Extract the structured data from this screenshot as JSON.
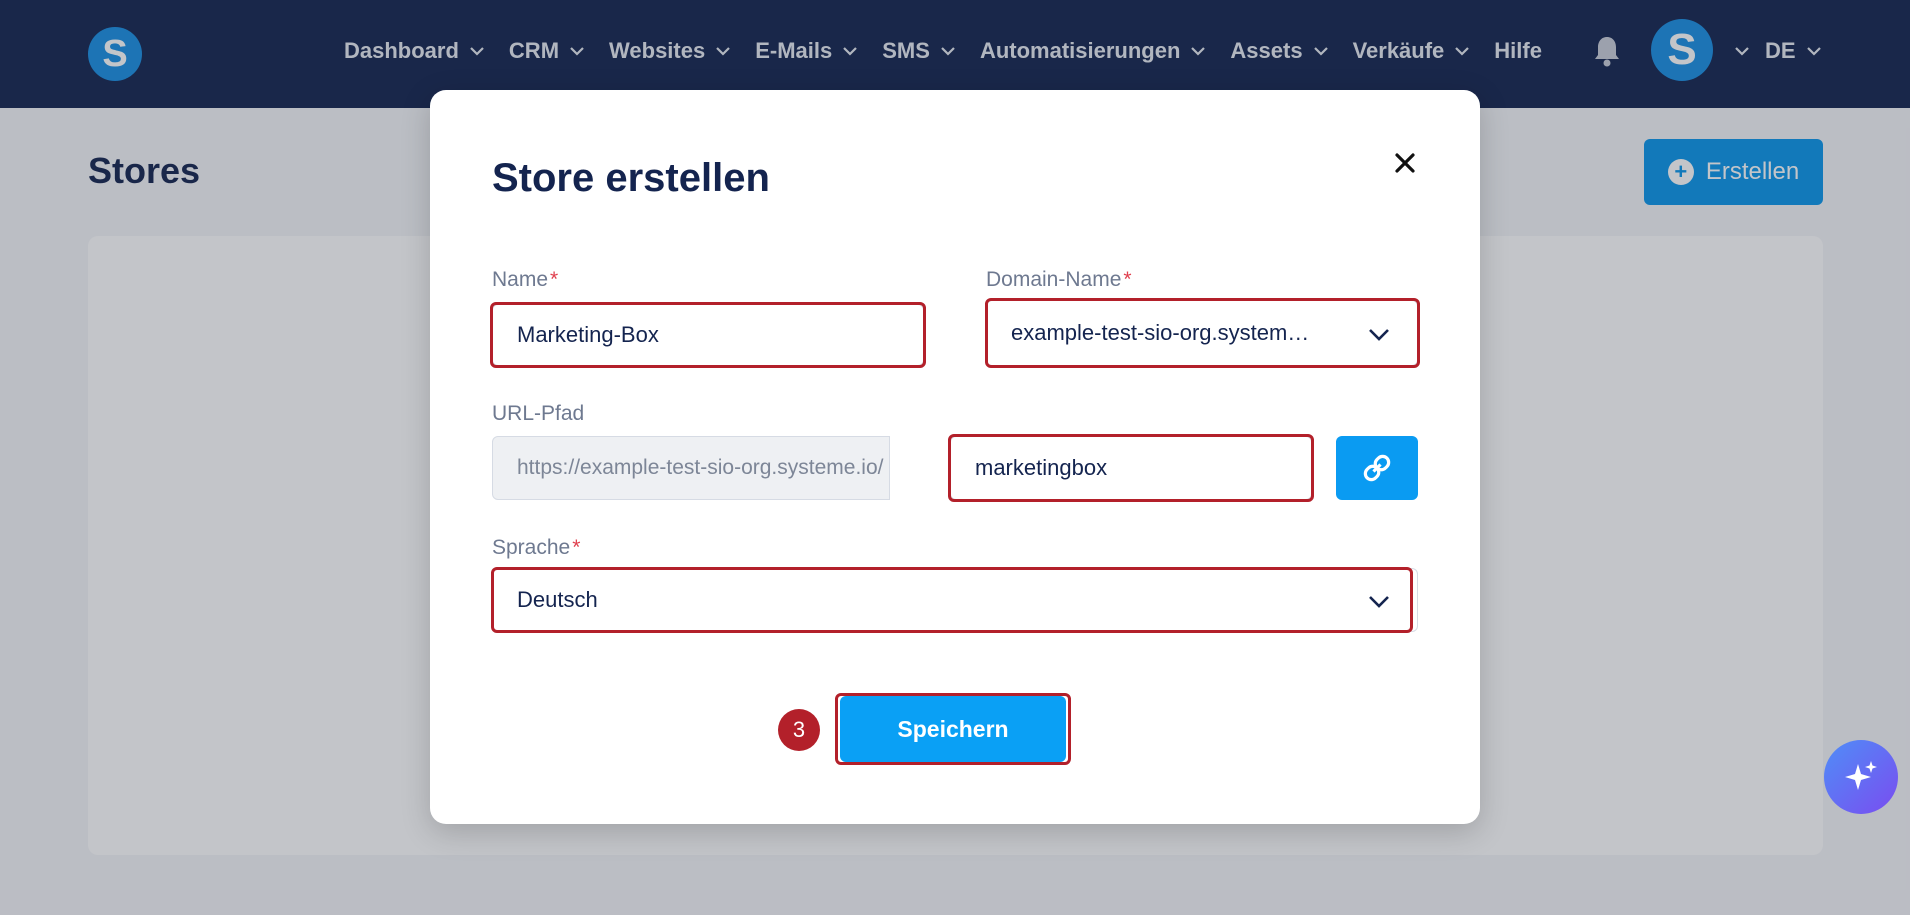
{
  "nav": {
    "logo_letter": "S",
    "items": [
      {
        "label": "Dashboard",
        "has_dropdown": true
      },
      {
        "label": "CRM",
        "has_dropdown": true
      },
      {
        "label": "Websites",
        "has_dropdown": true
      },
      {
        "label": "E-Mails",
        "has_dropdown": true
      },
      {
        "label": "SMS",
        "has_dropdown": true
      },
      {
        "label": "Automatisierungen",
        "has_dropdown": true
      },
      {
        "label": "Assets",
        "has_dropdown": true
      },
      {
        "label": "Verkäufe",
        "has_dropdown": true
      },
      {
        "label": "Hilfe",
        "has_dropdown": false
      }
    ],
    "bell_icon": "bell-icon",
    "avatar_letter": "S",
    "language": "DE"
  },
  "page": {
    "title": "Stores",
    "create_label": "Erstellen"
  },
  "modal": {
    "title": "Store erstellen",
    "close_icon": "close-icon",
    "name": {
      "label": "Name",
      "required": "*",
      "value": "Marketing-Box"
    },
    "domain": {
      "label": "Domain-Name",
      "required": "*",
      "value": "example-test-sio-org.system…"
    },
    "url": {
      "label": "URL-Pfad",
      "prefix": "https://example-test-sio-org.systeme.io/",
      "value": "marketingbox",
      "link_icon": "link-icon"
    },
    "language": {
      "label": "Sprache",
      "required": "*",
      "value": "Deutsch"
    },
    "save_label": "Speichern",
    "step_number": "3"
  },
  "colors": {
    "nav_bg": "#14244f",
    "accent": "#0a96ea",
    "highlight": "#b3202a"
  }
}
